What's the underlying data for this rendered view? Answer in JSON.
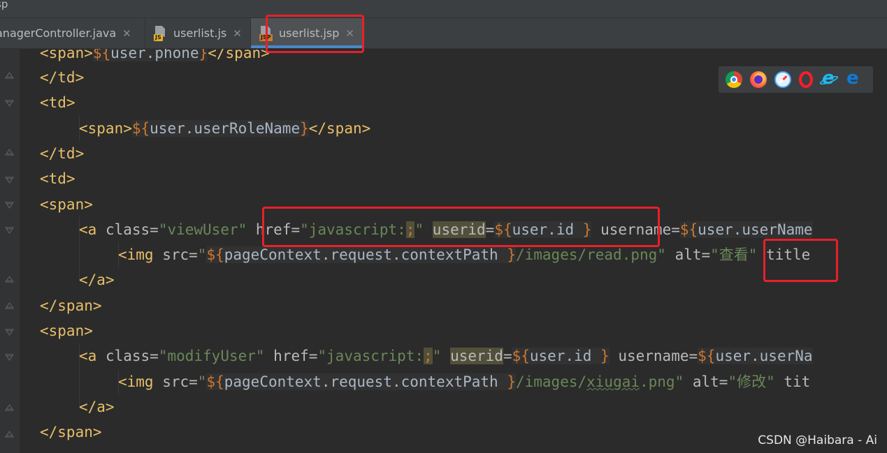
{
  "window": {
    "title_fragment": "sp"
  },
  "tabs": [
    {
      "label": "ManagerController.java",
      "visible_label": "anagerController.java",
      "active": false,
      "icon": "java-file-icon"
    },
    {
      "label": "userlist.js",
      "active": false,
      "icon": "js-file-icon",
      "badge": "JS"
    },
    {
      "label": "userlist.jsp",
      "active": true,
      "icon": "jsp-file-icon",
      "badge": "JSP"
    }
  ],
  "editor": {
    "language": "jsp",
    "lines": [
      {
        "text": "<span>${user.phone}</span>"
      },
      {
        "text": "</td>"
      },
      {
        "text": "<td>"
      },
      {
        "text": "<span>${user.userRoleName}</span>"
      },
      {
        "text": "</td>"
      },
      {
        "text": "<td>"
      },
      {
        "text": "<span>"
      },
      {
        "text": "<a class=\"viewUser\" href=\"javascript:;\" userid=${user.id } username=${user.userName"
      },
      {
        "text": "<img src=\"${pageContext.request.contextPath }/images/read.png\" alt=\"查看\" title"
      },
      {
        "text": "</a>"
      },
      {
        "text": "</span>"
      },
      {
        "text": "<span>"
      },
      {
        "text": "<a class=\"modifyUser\" href=\"javascript:;\" userid=${user.id } username=${user.userNa"
      },
      {
        "text": "<img src=\"${pageContext.request.contextPath }/images/xiugai.png\" alt=\"修改\" tit"
      },
      {
        "text": "</a>"
      },
      {
        "text": "</span>"
      }
    ],
    "tokens": {
      "l0": {
        "open": "<span>",
        "el_open": "${",
        "el_body": "user.phone",
        "el_close": "}",
        "close": "</span>"
      },
      "l1": {
        "tag": "</td>"
      },
      "l2": {
        "tag": "<td>"
      },
      "l3": {
        "open": "<span>",
        "el_open": "${",
        "el_body": "user.userRoleName",
        "el_close": "}",
        "close": "</span>"
      },
      "l4": {
        "tag": "</td>"
      },
      "l5": {
        "tag": "<td>"
      },
      "l6": {
        "tag": "<span>"
      },
      "l7": {
        "a_open": "<a",
        "class_attr": " class=",
        "class_val": "\"viewUser\"",
        "href_attr": " href=",
        "href_q": "\"javascript:",
        "href_semi": ";",
        "href_end": "\"",
        "sp": " ",
        "userid_attr": "userid",
        "eq": "=",
        "el_open": "${",
        "el_body": "user.id ",
        "el_close": "}",
        "username_attr": " username=",
        "el2_open": "${",
        "el2_body": "user.userName"
      },
      "l8": {
        "img_open": "<img",
        "src_attr": " src=",
        "q1": "\"",
        "el_open": "${",
        "el_body": "pageContext.request.contextPath ",
        "el_close": "}",
        "path": "/images/read.png\"",
        "alt_attr": " alt=",
        "alt_val": "\"查看\"",
        "title_attr": " title"
      },
      "l9": {
        "tag": "</a>"
      },
      "l10": {
        "tag": "</span>"
      },
      "l11": {
        "tag": "<span>"
      },
      "l12": {
        "a_open": "<a",
        "class_attr": " class=",
        "class_val": "\"modifyUser\"",
        "href_attr": " href=",
        "href_q": "\"javascript:",
        "href_semi": ";",
        "href_end": "\"",
        "sp": " ",
        "userid_attr": "userid",
        "eq": "=",
        "el_open": "${",
        "el_body": "user.id ",
        "el_close": "}",
        "username_attr": " username=",
        "el2_open": "${",
        "el2_body": "user.userNa"
      },
      "l13": {
        "img_open": "<img",
        "src_attr": " src=",
        "q1": "\"",
        "el_open": "${",
        "el_body": "pageContext.request.contextPath ",
        "el_close": "}",
        "path_a": "/images/",
        "path_b": "xiugai",
        "path_c": ".png\"",
        "alt_attr": " alt=",
        "alt_val": "\"修改\"",
        "title_attr": " tit"
      },
      "l14": {
        "tag": "</a>"
      },
      "l15": {
        "tag": "</span>"
      }
    }
  },
  "browser_icons": [
    "chrome-icon",
    "firefox-icon",
    "safari-icon",
    "opera-icon",
    "internet-explorer-icon",
    "edge-icon"
  ],
  "watermark": "CSDN @Haibara - Ai",
  "colors": {
    "background": "#2b2b2b",
    "tag": "#e8bf6a",
    "attribute": "#bababa",
    "string": "#6a8759",
    "el_delimiter": "#cc7832",
    "active_tab_underline": "#4a88c7",
    "annotation": "#e8202a"
  }
}
